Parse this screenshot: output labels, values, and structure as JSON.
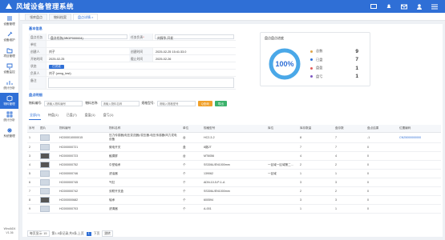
{
  "app": {
    "title": "风域设备管理系统"
  },
  "header": {
    "icons": [
      "screen-icon",
      "bell-icon",
      "mail-icon",
      "user-icon",
      "menu-icon"
    ]
  },
  "sidebar": {
    "items": [
      {
        "label": "设备管理",
        "icon": "list-icon"
      },
      {
        "label": "设备维护",
        "icon": "wrench-icon"
      },
      {
        "label": "项目管理",
        "icon": "folder-icon"
      },
      {
        "label": "设备监控",
        "icon": "monitor-icon"
      },
      {
        "label": "统计分析",
        "icon": "chart-icon"
      },
      {
        "label": "物料管理",
        "icon": "box-icon",
        "active": true
      },
      {
        "label": "统计分析",
        "icon": "grid-icon"
      },
      {
        "label": "系统管理",
        "icon": "gear-icon"
      }
    ],
    "footer_user": "WindAD4",
    "footer_version": "V1.36"
  },
  "tabs": [
    {
      "label": "领库盘点",
      "active": false
    },
    {
      "label": "物料档案",
      "active": false
    },
    {
      "label": "盘点详情",
      "active": true
    }
  ],
  "tab_close": "×",
  "basic": {
    "section_title": "基本信息",
    "rows": [
      {
        "l1": "盘点任务",
        "v1": "盘点任务(3RGP000004)",
        "l2": "任务负责",
        "v2": "刘保华,开发",
        "v2_req": "*"
      },
      {
        "l1": "单位",
        "v1": ""
      },
      {
        "l1": "创建人",
        "v1": "刘子",
        "l2": "创建时间",
        "v2": "2025-02-25 15:41:33.0"
      },
      {
        "l1": "开始时间",
        "v1": "2025-02-25",
        "l2": "截止时间",
        "v2": "2025-02-26"
      },
      {
        "l1": "状态",
        "v1": "已完成"
      },
      {
        "l1": "负责人",
        "v1": "刘子 (zeng_test)"
      },
      {
        "l1": "备注",
        "v1": ""
      }
    ]
  },
  "stats": {
    "title": "盘点盘点进度",
    "percent": "100%",
    "items": [
      {
        "name": "总数",
        "value": "9",
        "color": "#e0a64b"
      },
      {
        "name": "已盘",
        "value": "7",
        "color": "#2f6fd6"
      },
      {
        "name": "盘盈",
        "value": "1",
        "color": "#e25c5c"
      },
      {
        "name": "盘亏",
        "value": "1",
        "color": "#7e57c2"
      }
    ],
    "ring_color": "#4aa8e8",
    "ring_track": "#e6eef7"
  },
  "details": {
    "section_title": "盘点明细"
  },
  "search": {
    "label1": "物料编号:",
    "ph1": "请输入物料编号",
    "label2": "物料名称:",
    "ph2": "请输入物料名称",
    "label3": "规格型号:",
    "ph3": "请输入规格型号",
    "search_btn": "Q查询",
    "export_btn": "导出"
  },
  "subtabs": [
    "全部(9)",
    "待盘(1)",
    "已盘(7)",
    "盘盈(1)",
    "盘亏(1)"
  ],
  "table": {
    "headers": [
      "序号",
      "图片",
      "物料编号",
      "物料名称",
      "单位",
      "规格型号",
      "库位",
      "库存数量",
      "盘存数",
      "盘点结果",
      "位置编码"
    ],
    "rows": [
      {
        "no": "1",
        "img": "light",
        "code": "HC000010000015",
        "name": "压力传感器(电压变送器)/变压器-电压传感器/风力发电设备",
        "unit": "台",
        "spec": "HC2-3-2",
        "loc": "",
        "stock": "8",
        "count": "7",
        "result": "-1",
        "pos": "CN25000000000"
      },
      {
        "no": "2",
        "img": "light",
        "code": "HC000000721",
        "name": "微电开关",
        "unit": "盒",
        "spec": "8路2T",
        "loc": "",
        "stock": "7",
        "count": "7",
        "result": "0",
        "pos": ""
      },
      {
        "no": "3",
        "img": "dark",
        "code": "HC000000723",
        "name": "触摸屏",
        "unit": "台",
        "spec": "MT6056",
        "loc": "",
        "stock": "4",
        "count": "4",
        "result": "0",
        "pos": ""
      },
      {
        "no": "4",
        "img": "dark",
        "code": "HC000000752",
        "name": "中型轴承",
        "unit": "个",
        "spec": "SS306L/EN1000mm",
        "loc": "一区域一区域第二...",
        "stock": "2",
        "count": "2",
        "result": "0",
        "pos": ""
      },
      {
        "no": "5",
        "img": "light",
        "code": "HC000000746",
        "name": "滤油器",
        "unit": "个",
        "spec": "139062",
        "loc": "一区域",
        "stock": "1",
        "count": "1",
        "result": "0",
        "pos": ""
      },
      {
        "no": "6",
        "img": "light",
        "code": "HC000000745",
        "name": "气缸",
        "unit": "个",
        "spec": "ADN-10-5-P-1-A",
        "loc": "",
        "stock": "3",
        "count": "3",
        "result": "0",
        "pos": ""
      },
      {
        "no": "7",
        "img": "light",
        "code": "HC000000742",
        "name": "双联开关盒",
        "unit": "个",
        "spec": "SS306L/EN1000mm",
        "loc": "",
        "stock": "2",
        "count": "2",
        "result": "0",
        "pos": ""
      },
      {
        "no": "8",
        "img": "dark",
        "code": "HC000000682",
        "name": "轴承",
        "unit": "个",
        "spec": "600594",
        "loc": "",
        "stock": "3",
        "count": "3",
        "result": "0",
        "pos": ""
      },
      {
        "no": "9",
        "img": "light",
        "code": "HC000000703",
        "name": "滤清器",
        "unit": "个",
        "spec": "A-001",
        "loc": "",
        "stock": "1",
        "count": "1",
        "result": "0",
        "pos": ""
      }
    ]
  },
  "pager": {
    "per_page": "每页显示: 15",
    "range": "第1-9条记录,共9条,上页",
    "page": "1",
    "next": "下页",
    "go": "跳转"
  }
}
